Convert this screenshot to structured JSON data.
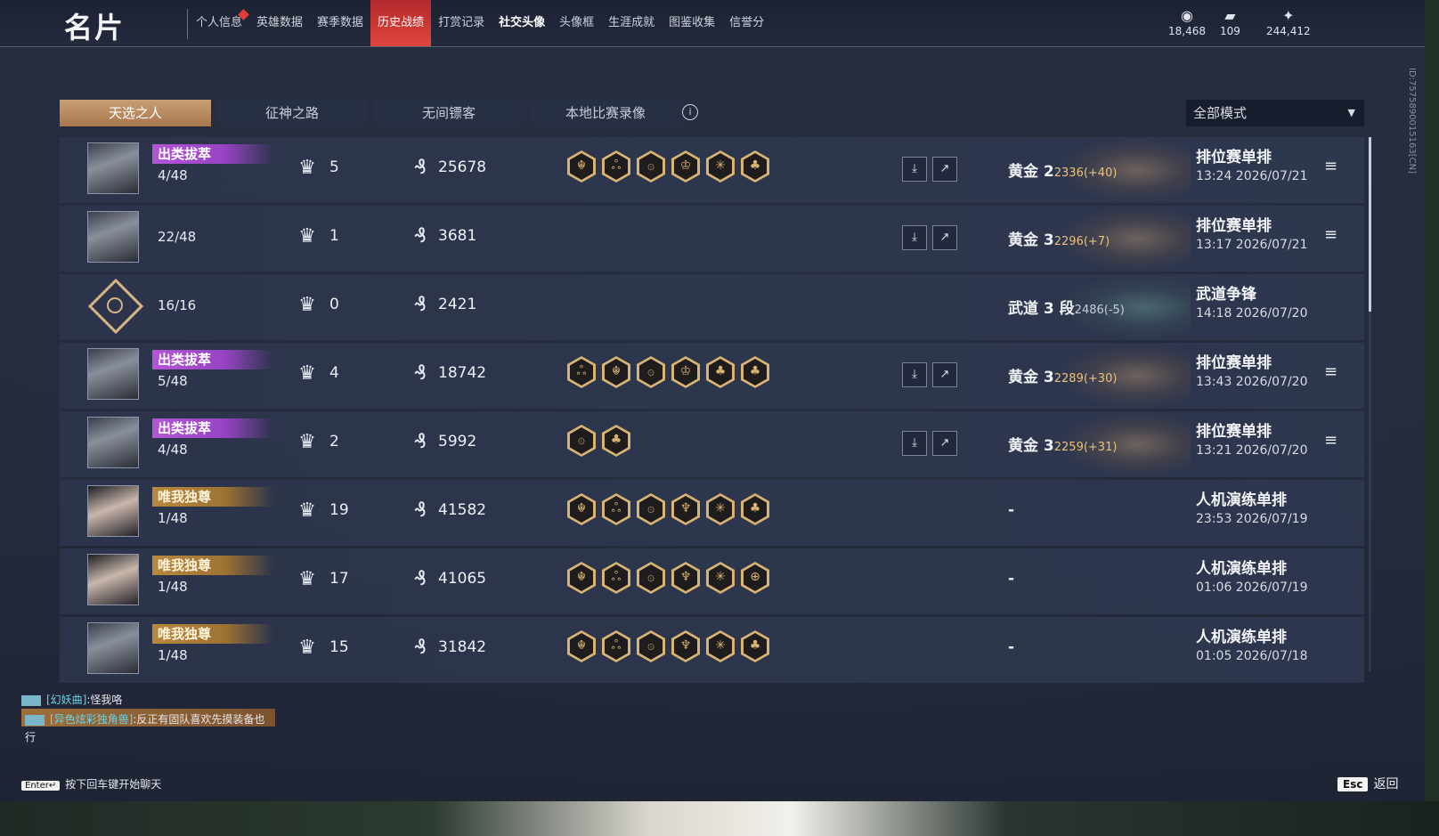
{
  "header": {
    "title": "名片",
    "nav": [
      {
        "label": "个人信息",
        "badge": true,
        "active": false,
        "bold": false
      },
      {
        "label": "英雄数据",
        "active": false,
        "bold": false
      },
      {
        "label": "赛季数据",
        "active": false,
        "bold": false
      },
      {
        "label": "历史战绩",
        "active": true,
        "bold": false
      },
      {
        "label": "打赏记录",
        "active": false,
        "bold": false
      },
      {
        "label": "社交头像",
        "active": false,
        "bold": true
      },
      {
        "label": "头像框",
        "active": false,
        "bold": false
      },
      {
        "label": "生涯成就",
        "active": false,
        "bold": false
      },
      {
        "label": "图鉴收集",
        "active": false,
        "bold": false
      },
      {
        "label": "信誉分",
        "active": false,
        "bold": false
      }
    ],
    "currencies": [
      {
        "icon": "coin-icon",
        "glyph": "◉",
        "value": "18,468"
      },
      {
        "icon": "ticket-icon",
        "glyph": "▰",
        "value": "109"
      },
      {
        "icon": "feather-icon",
        "glyph": "✦",
        "value": "244,412"
      }
    ],
    "side_id": "ID:7575890015163[CN]"
  },
  "subtabs": [
    {
      "label": "天选之人",
      "active": true
    },
    {
      "label": "征神之路",
      "active": false
    },
    {
      "label": "无间镖客",
      "active": false
    },
    {
      "label": "本地比赛录像",
      "active": false
    }
  ],
  "mode_filter": {
    "value": "全部模式"
  },
  "rows": [
    {
      "avatar": "hero",
      "badge": "出类拔萃",
      "badge_color": "purple",
      "rank": "4/48",
      "kills": "5",
      "money": "25678",
      "awards": [
        "☬",
        "ஃ",
        "۞",
        "♔",
        "✳",
        "♣"
      ],
      "actions": true,
      "tier": "黄金 2",
      "pts": "2336(+40)",
      "pts_neg": false,
      "mode": "排位赛单排",
      "time": "13:24 2026/07/21",
      "menu": true,
      "art": "gold"
    },
    {
      "avatar": "hero",
      "badge": "",
      "badge_color": "",
      "rank": "22/48",
      "kills": "1",
      "money": "3681",
      "awards": [],
      "actions": true,
      "tier": "黄金 3",
      "pts": "2296(+7)",
      "pts_neg": false,
      "mode": "排位赛单排",
      "time": "13:17 2026/07/21",
      "menu": true,
      "art": "gold"
    },
    {
      "avatar": "emblem",
      "badge": "",
      "badge_color": "",
      "rank": "16/16",
      "kills": "0",
      "money": "2421",
      "awards": [],
      "actions": false,
      "tier": "武道 3 段",
      "pts": "2486(-5)",
      "pts_neg": true,
      "mode": "武道争锋",
      "time": "14:18 2026/07/20",
      "menu": false,
      "art": "jade"
    },
    {
      "avatar": "hero",
      "badge": "出类拔萃",
      "badge_color": "purple",
      "rank": "5/48",
      "kills": "4",
      "money": "18742",
      "awards": [
        "ஃ",
        "☬",
        "۞",
        "♔",
        "♣",
        "♣"
      ],
      "actions": true,
      "tier": "黄金 3",
      "pts": "2289(+30)",
      "pts_neg": false,
      "mode": "排位赛单排",
      "time": "13:43 2026/07/20",
      "menu": true,
      "art": "gold"
    },
    {
      "avatar": "hero",
      "badge": "出类拔萃",
      "badge_color": "purple",
      "rank": "4/48",
      "kills": "2",
      "money": "5992",
      "awards": [
        "۞",
        "♣"
      ],
      "actions": true,
      "tier": "黄金 3",
      "pts": "2259(+31)",
      "pts_neg": false,
      "mode": "排位赛单排",
      "time": "13:21 2026/07/20",
      "menu": true,
      "art": "gold"
    },
    {
      "avatar": "face2",
      "badge": "唯我独尊",
      "badge_color": "gold",
      "rank": "1/48",
      "kills": "19",
      "money": "41582",
      "awards": [
        "☬",
        "ஃ",
        "۞",
        "♆",
        "✳",
        "♣"
      ],
      "actions": false,
      "tier": "-",
      "pts": "",
      "pts_neg": false,
      "mode": "人机演练单排",
      "time": "23:53 2026/07/19",
      "menu": false,
      "art": ""
    },
    {
      "avatar": "face2",
      "badge": "唯我独尊",
      "badge_color": "gold",
      "rank": "1/48",
      "kills": "17",
      "money": "41065",
      "awards": [
        "☬",
        "ஃ",
        "۞",
        "♆",
        "✳",
        "⊕"
      ],
      "actions": false,
      "tier": "-",
      "pts": "",
      "pts_neg": false,
      "mode": "人机演练单排",
      "time": "01:06 2026/07/19",
      "menu": false,
      "art": ""
    },
    {
      "avatar": "hero",
      "badge": "唯我独尊",
      "badge_color": "gold",
      "rank": "1/48",
      "kills": "15",
      "money": "31842",
      "awards": [
        "☬",
        "ஃ",
        "۞",
        "♆",
        "✳",
        "♣"
      ],
      "actions": false,
      "tier": "-",
      "pts": "",
      "pts_neg": false,
      "mode": "人机演练单排",
      "time": "01:05 2026/07/18",
      "menu": false,
      "art": ""
    }
  ],
  "chat": {
    "lines": [
      {
        "user": "[幻妖曲]",
        "text": ":怪我咯",
        "highlight": false
      },
      {
        "user": "[异色炫彩独角兽]",
        "text": ":反正有固队喜欢先摸装备也行",
        "highlight": true
      }
    ],
    "hint_key": "Enter↵",
    "hint": "按下回车键开始聊天"
  },
  "footer": {
    "esc_key": "Esc",
    "esc_label": "返回"
  }
}
